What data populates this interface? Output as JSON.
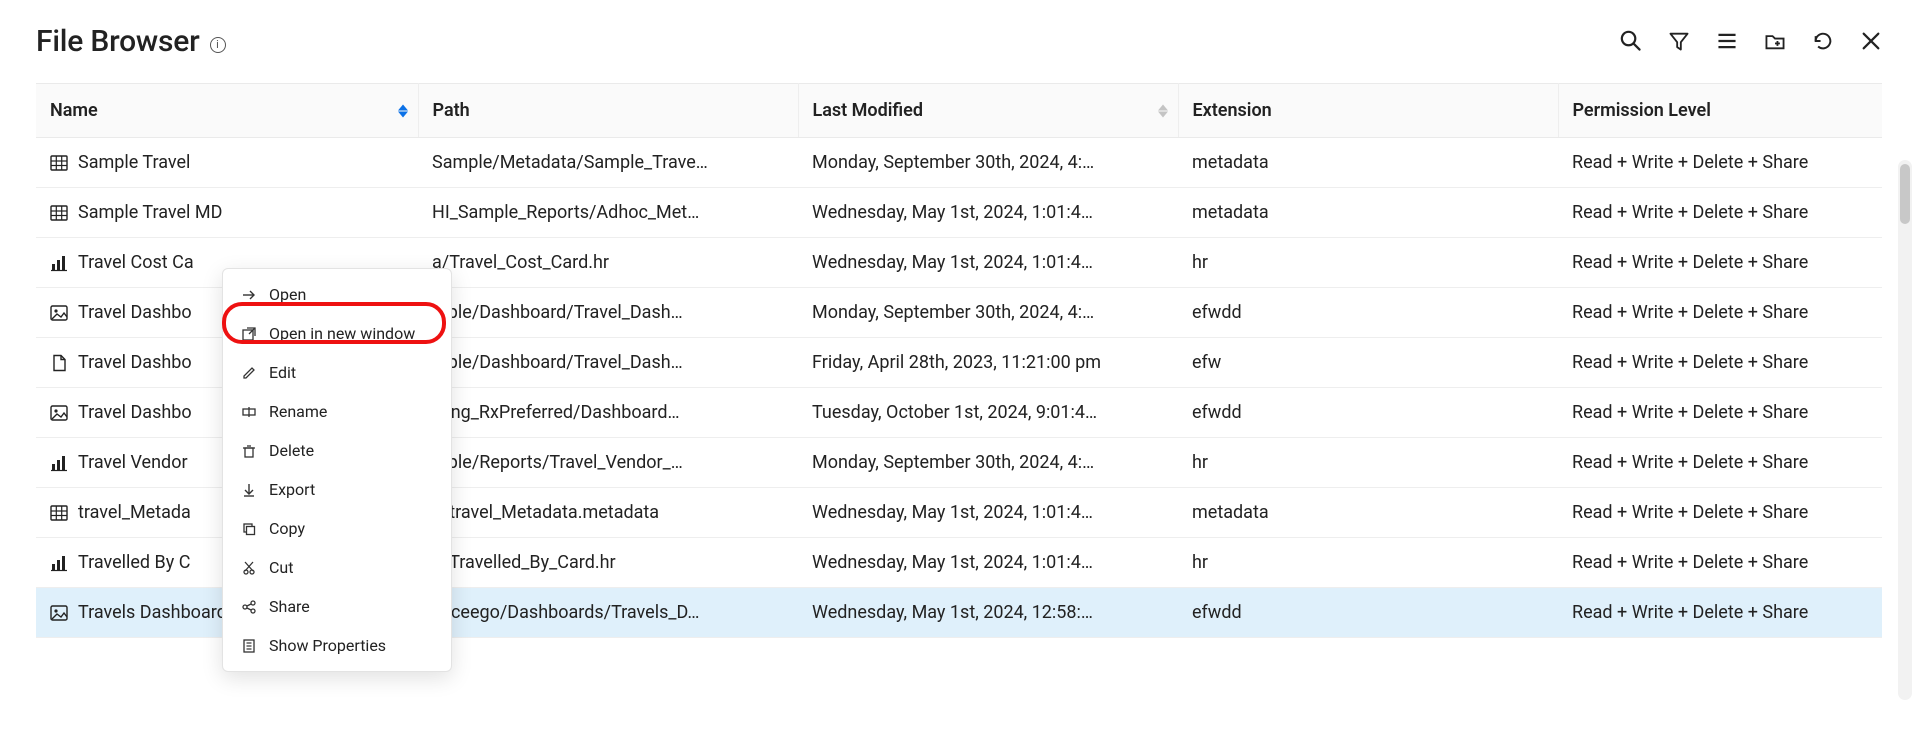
{
  "title": "File Browser",
  "info_tooltip": "i",
  "columns": {
    "name": "Name",
    "path": "Path",
    "modified": "Last Modified",
    "extension": "Extension",
    "permission": "Permission Level"
  },
  "rows": [
    {
      "icon": "table",
      "name": "Sample Travel",
      "path": "Sample/Metadata/Sample_Trave…",
      "modified": "Monday, September 30th, 2024, 4:…",
      "ext": "metadata",
      "perm": "Read + Write + Delete + Share",
      "selected": false
    },
    {
      "icon": "table",
      "name": "Sample Travel MD",
      "path": "HI_Sample_Reports/Adhoc_Met…",
      "modified": "Wednesday, May 1st, 2024, 1:01:4…",
      "ext": "metadata",
      "perm": "Read + Write + Delete + Share",
      "selected": false
    },
    {
      "icon": "bar",
      "name": "Travel Cost Ca",
      "path": "a/Travel_Cost_Card.hr",
      "modified": "Wednesday, May 1st, 2024, 1:01:4…",
      "ext": "hr",
      "perm": "Read + Write + Delete + Share",
      "selected": false
    },
    {
      "icon": "image",
      "name": "Travel Dashbo",
      "path": "mple/Dashboard/Travel_Dash…",
      "modified": "Monday, September 30th, 2024, 4:…",
      "ext": "efwdd",
      "perm": "Read + Write + Delete + Share",
      "selected": false
    },
    {
      "icon": "doc",
      "name": "Travel Dashbo",
      "path": "mple/Dashboard/Travel_Dash…",
      "modified": "Friday, April 28th, 2023, 11:21:00 pm",
      "ext": "efw",
      "perm": "Read + Write + Delete + Share",
      "selected": false
    },
    {
      "icon": "image",
      "name": "Travel Dashbo",
      "path": "ining_RxPreferred/Dashboard…",
      "modified": "Tuesday, October 1st, 2024, 9:01:4…",
      "ext": "efwdd",
      "perm": "Read + Write + Delete + Share",
      "selected": false
    },
    {
      "icon": "bar",
      "name": "Travel Vendor",
      "path": "mple/Reports/Travel_Vendor_…",
      "modified": "Monday, September 30th, 2024, 4:…",
      "ext": "hr",
      "perm": "Read + Write + Delete + Share",
      "selected": false
    },
    {
      "icon": "table",
      "name": "travel_Metada",
      "path": "a/travel_Metadata.metadata",
      "modified": "Wednesday, May 1st, 2024, 1:01:4…",
      "ext": "metadata",
      "perm": "Read + Write + Delete + Share",
      "selected": false
    },
    {
      "icon": "bar",
      "name": "Travelled By C",
      "path": "a/Travelled_By_Card.hr",
      "modified": "Wednesday, May 1st, 2024, 1:01:4…",
      "ext": "hr",
      "perm": "Read + Write + Delete + Share",
      "selected": false
    },
    {
      "icon": "image",
      "name": "Travels Dashboard",
      "path": "Exceego/Dashboards/Travels_D…",
      "modified": "Wednesday, May 1st, 2024, 12:58:…",
      "ext": "efwdd",
      "perm": "Read + Write + Delete + Share",
      "selected": true
    }
  ],
  "context_menu": [
    {
      "icon": "arrow-right",
      "label": "Open"
    },
    {
      "icon": "open-win",
      "label": "Open in new window"
    },
    {
      "icon": "edit",
      "label": "Edit"
    },
    {
      "icon": "rename",
      "label": "Rename"
    },
    {
      "icon": "trash",
      "label": "Delete"
    },
    {
      "icon": "download",
      "label": "Export"
    },
    {
      "icon": "copy",
      "label": "Copy"
    },
    {
      "icon": "cut",
      "label": "Cut"
    },
    {
      "icon": "share",
      "label": "Share"
    },
    {
      "icon": "props",
      "label": "Show Properties"
    }
  ]
}
